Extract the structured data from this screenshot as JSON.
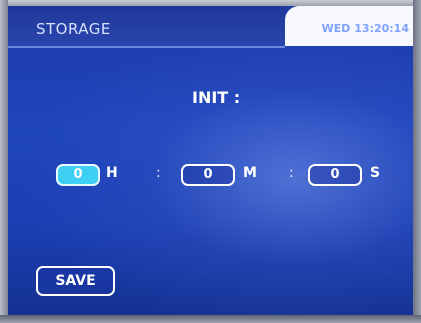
{
  "header": {
    "title": "STORAGE",
    "datetime": "WED 13:20:14"
  },
  "main": {
    "label": "INIT :",
    "hours": {
      "value": "0",
      "unit": "H"
    },
    "minutes": {
      "value": "0",
      "unit": "M"
    },
    "seconds": {
      "value": "0",
      "unit": "S"
    },
    "separator": ":"
  },
  "footer": {
    "save_label": "SAVE"
  },
  "colors": {
    "background": "#1f45bd",
    "active_field": "#3ed0f2",
    "header_panel": "#f7f9ff",
    "datetime_text": "#7fa2ff"
  }
}
